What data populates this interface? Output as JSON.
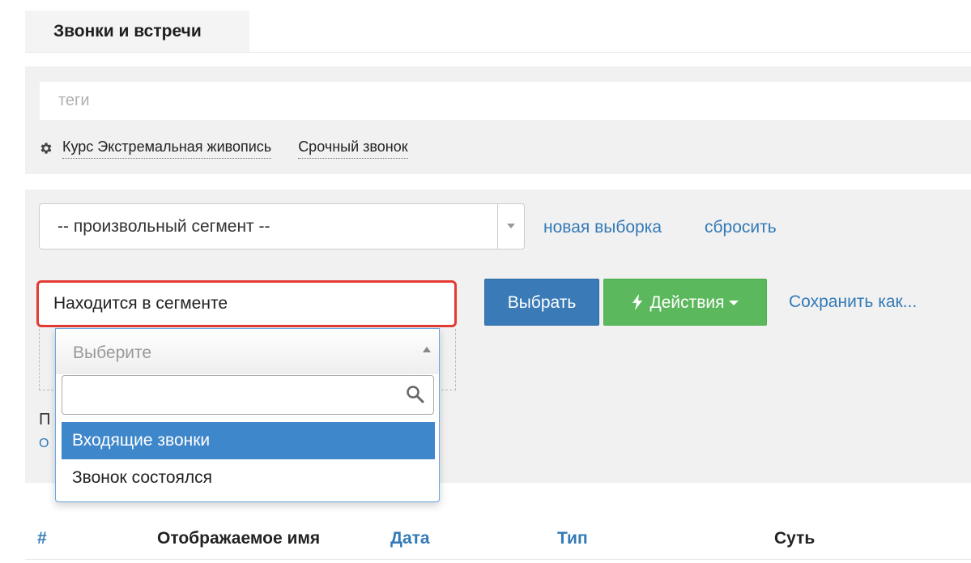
{
  "tab": {
    "title": "Звонки и встречи"
  },
  "tags": {
    "placeholder": "теги",
    "items": [
      "Курс Экстремальная живопись",
      "Срочный звонок"
    ]
  },
  "segment": {
    "selected": "-- произвольный сегмент --",
    "new_link": "новая выборка",
    "reset_link": "сбросить"
  },
  "condition": {
    "label": "Находится в сегменте"
  },
  "buttons": {
    "select": "Выбрать",
    "actions": "Действия",
    "save_as": "Сохранить как..."
  },
  "partial": {
    "line1": "П",
    "line2": "О"
  },
  "dropdown": {
    "placeholder": "Выберите",
    "search_value": "",
    "options": [
      "Входящие звонки",
      "Звонок состоялся"
    ],
    "active_index": 0
  },
  "table": {
    "columns": [
      "#",
      "Отображаемое имя",
      "Дата",
      "Тип",
      "Суть"
    ]
  },
  "colors": {
    "primary": "#3a7ab7",
    "success": "#5cb85c",
    "highlight_border": "#e23b32",
    "link": "#337ab7"
  }
}
